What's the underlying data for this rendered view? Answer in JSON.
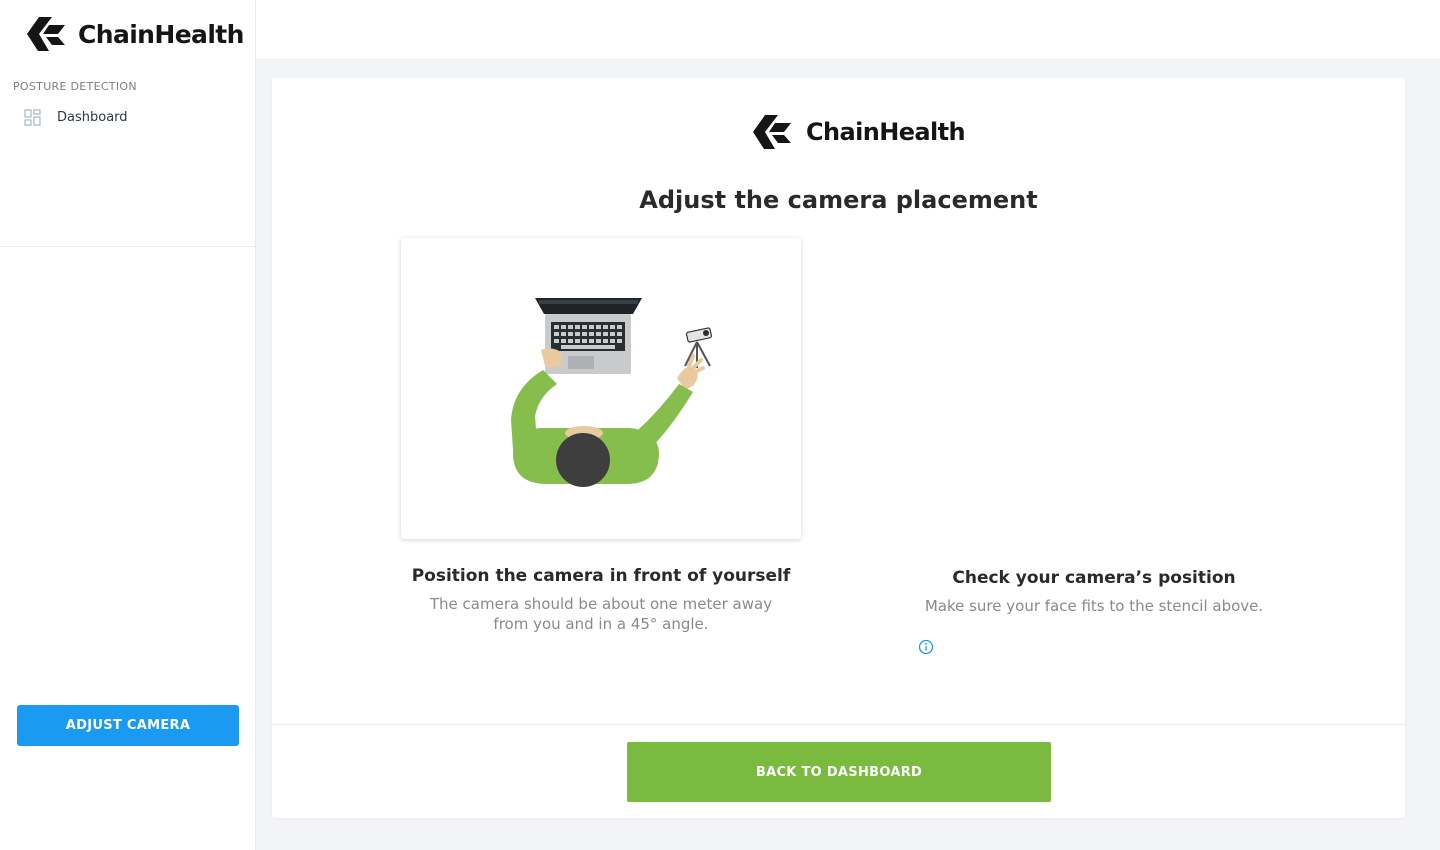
{
  "brand": {
    "name": "ChainHealth"
  },
  "sidebar": {
    "section_label": "POSTURE DETECTION",
    "items": [
      {
        "label": "Dashboard",
        "icon": "dashboard-grid-icon"
      }
    ],
    "adjust_button": "ADJUST CAMERA"
  },
  "main": {
    "title": "Adjust the camera placement",
    "left": {
      "title": "Position the camera in front of yourself",
      "text_line1": "The camera should be about one meter away",
      "text_line2": "from you and in a 45° angle."
    },
    "right": {
      "title": "Check your camera’s position",
      "text": "Make sure your face fits to the stencil above.",
      "icon": "info-icon"
    },
    "back_button": "BACK TO DASHBOARD"
  },
  "colors": {
    "primary_blue": "#1a9af0",
    "primary_green": "#7aba3f",
    "sweater_green": "#86be4e"
  }
}
